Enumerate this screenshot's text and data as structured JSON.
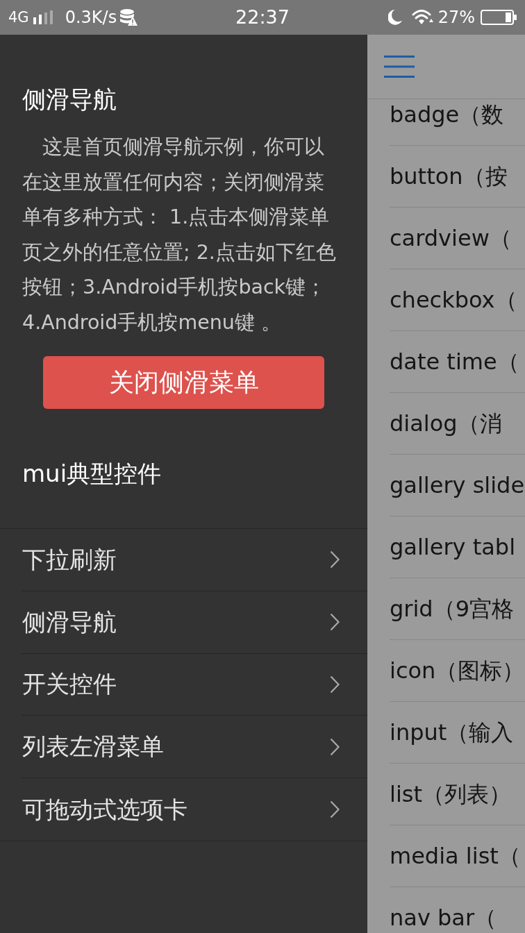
{
  "status_bar": {
    "network": "4G",
    "speed": "0.3K/s",
    "time": "22:37",
    "battery": "27%"
  },
  "side_menu": {
    "title": "侧滑导航",
    "description": "这是首页侧滑导航示例，你可以在这里放置任何内容；关闭侧滑菜单有多种方式： 1.点击本侧滑菜单页之外的任意位置; 2.点击如下红色按钮；3.Android手机按back键；4.Android手机按menu键 。",
    "close_button": "关闭侧滑菜单",
    "section_title": "mui典型控件",
    "items": [
      "下拉刷新",
      "侧滑导航",
      "开关控件",
      "列表左滑菜单",
      "可拖动式选项卡"
    ]
  },
  "main": {
    "list": [
      "badge（数",
      "button（按",
      "cardview（",
      "checkbox（",
      "date time（",
      "dialog（消",
      "gallery slide",
      "gallery tabl",
      "grid（9宫格",
      "icon（图标）",
      "input（输入",
      "list（列表）",
      "media list（",
      "nav bar（"
    ]
  }
}
